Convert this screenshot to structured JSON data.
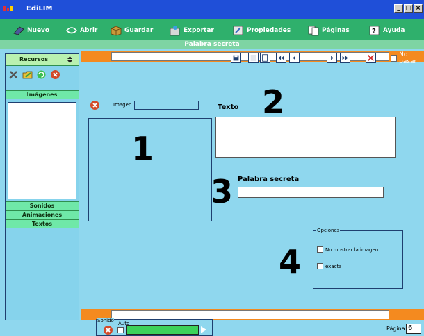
{
  "window": {
    "title": "EdiLIM"
  },
  "toolbar": {
    "items": [
      {
        "label": "Nuevo",
        "icon": "new-icon"
      },
      {
        "label": "Abrir",
        "icon": "open-icon"
      },
      {
        "label": "Guardar",
        "icon": "save-icon"
      },
      {
        "label": "Exportar",
        "icon": "export-icon"
      },
      {
        "label": "Propiedades",
        "icon": "properties-icon"
      },
      {
        "label": "Páginas",
        "icon": "pages-icon"
      },
      {
        "label": "Ayuda",
        "icon": "help-icon"
      }
    ]
  },
  "section": {
    "title": "Palabra secreta"
  },
  "sidebar": {
    "header": "Recursos",
    "tabs": [
      "Imágenes",
      "Sonidos",
      "Animaciones",
      "Textos"
    ]
  },
  "top_bar": {
    "no_pasar": "No pasar"
  },
  "editor": {
    "image_label": "Imagen",
    "texto_label": "Texto",
    "palabra_label": "Palabra secreta",
    "numbers": [
      "1",
      "2",
      "3",
      "4"
    ],
    "options": {
      "legend": "Opciones",
      "items": [
        "No mostrar la imagen",
        "exacta"
      ]
    }
  },
  "bottom": {
    "sound_legend": "Sonido",
    "auto_label": "Auto",
    "page_label": "Página",
    "page_value": "6"
  },
  "colors": {
    "titlebar": "#1f4fd8",
    "toolbar": "#2fb06c",
    "panel": "#8fd7ee",
    "accent": "#f48a1f"
  }
}
